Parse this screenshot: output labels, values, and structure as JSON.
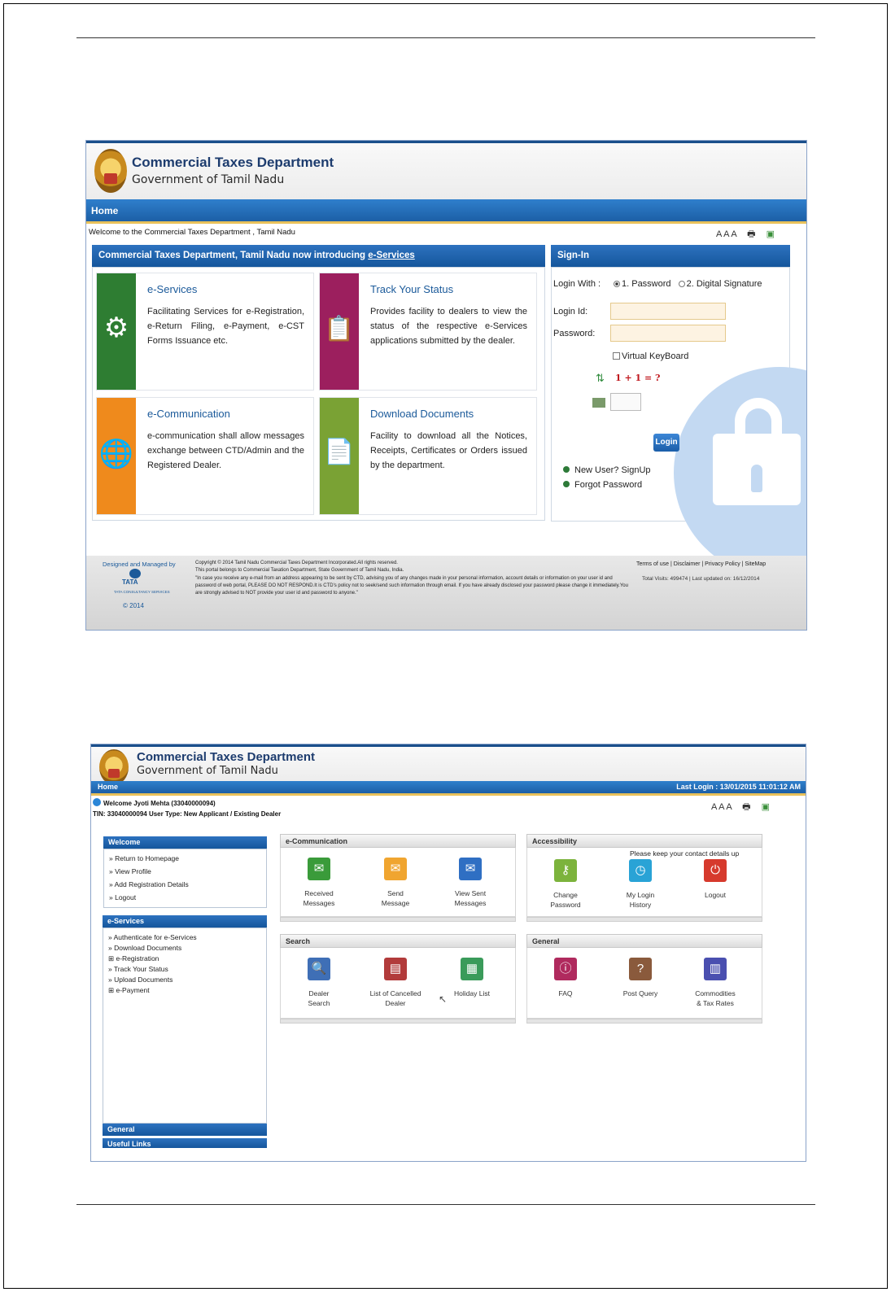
{
  "login_page": {
    "brand_title": "Commercial Taxes Department",
    "brand_subtitle": "Government of Tamil Nadu",
    "nav_home": "Home",
    "welcome_text": "Welcome to the Commercial Taxes Department , Tamil Nadu",
    "font_size_controls": "A A A",
    "intro_heading_prefix": "Commercial Taxes Department, Tamil Nadu now introducing ",
    "intro_heading_link": "e-Services",
    "cards": [
      {
        "title": "e-Services",
        "description": "Facilitating Services for e-Registration, e-Return Filing, e-Payment, e-CST Forms Issuance etc.",
        "color": "#2e7d32",
        "icon": "gears-icon"
      },
      {
        "title": "Track Your Status",
        "description": "Provides facility to dealers to view the status of the respective e-Services applications submitted by the dealer.",
        "color": "#9c1f5e",
        "icon": "clipboard-icon"
      },
      {
        "title": "e-Communication",
        "description": "e-communication shall allow messages exchange between CTD/Admin and the Registered Dealer.",
        "color": "#ef8a1c",
        "icon": "globe-icon"
      },
      {
        "title": "Download Documents",
        "description": "Facility to download all the Notices, Receipts, Certificates or Orders issued by the department.",
        "color": "#7aa234",
        "icon": "document-icon"
      }
    ],
    "signin": {
      "heading": "Sign-In",
      "login_with_label": "Login With :",
      "option1": "1. Password",
      "option2": "2. Digital Signature",
      "login_id_label": "Login Id:",
      "login_id_value": "",
      "password_label": "Password:",
      "password_value": "",
      "virtual_keyboard": "Virtual KeyBoard",
      "captcha": "1 + 1 = ?",
      "login_button": "Login",
      "new_user": "New User? SignUp",
      "forgot_password": "Forgot Password"
    },
    "footer": {
      "designed_by": "Designed and Managed by",
      "tata": "TATA",
      "tcs": "TATA CONSULTANCY SERVICES",
      "year": "© 2014",
      "copyright": "Copyright © 2014 Tamil Nadu Commercial Taxes Department Incorporated.All rights reserved.",
      "portal_note": "This portal belongs to Commercial Taxation Department, State Government of Tamil Nadu, India.",
      "warning": "\"In case you receive any e-mail from an address appearing to be sent by CTD, advising you of any changes made in your personal information, account details or information on your user id and password of web portal, PLEASE DO NOT RESPOND.It is CTD's policy not to seek/send such information through email. If you have already disclosed your password please change it immediately.You are strongly advised to NOT provide your user id and password to anyone.\"",
      "links": "Terms of use | Disclaimer | Privacy Policy | SiteMap",
      "visits": "Total Visits: 499474 | Last updated on: 16/12/2014"
    }
  },
  "dashboard": {
    "brand_title": "Commercial Taxes Department",
    "brand_subtitle": "Government of Tamil Nadu",
    "nav_home": "Home",
    "last_login": "Last Login : 13/01/2015 11:01:12 AM",
    "welcome_user": "Welcome Jyoti Mehta (33040000094)",
    "tin_line": "TIN: 33040000094   User Type: New Applicant / Existing Dealer",
    "font_size_controls": "A A A",
    "sidebar": {
      "welcome_heading": "Welcome",
      "welcome_items": [
        "» Return to Homepage",
        "» View Profile",
        "» Add Registration Details",
        "» Logout"
      ],
      "eservices_heading": "e-Services",
      "eservices_items": [
        "» Authenticate for e-Services",
        "» Download Documents",
        "⊞ e-Registration",
        "» Track Your Status",
        "» Upload Documents",
        "⊞ e-Payment"
      ],
      "general_heading": "General",
      "useful_links_heading": "Useful Links"
    },
    "widgets": {
      "ecommunication": {
        "title": "e-Communication",
        "tiles": [
          {
            "label1": "Received",
            "label2": "Messages",
            "color": "#3a9b3a",
            "icon": "envelope-icon"
          },
          {
            "label1": "Send",
            "label2": "Message",
            "color": "#f0a530",
            "icon": "send-mail-icon"
          },
          {
            "label1": "View Sent",
            "label2": "Messages",
            "color": "#2f6fc3",
            "icon": "sent-mail-icon"
          }
        ]
      },
      "accessibility": {
        "title": "Accessibility",
        "notice": "Please keep your contact details up",
        "tiles": [
          {
            "label1": "Change",
            "label2": "Password",
            "color": "#7cb33c",
            "icon": "key-icon"
          },
          {
            "label1": "My Login",
            "label2": "History",
            "color": "#29a3d6",
            "icon": "history-icon"
          },
          {
            "label1": "Logout",
            "label2": "",
            "color": "#d63a2d",
            "icon": "power-icon"
          }
        ]
      },
      "search": {
        "title": "Search",
        "tiles": [
          {
            "label1": "Dealer",
            "label2": "Search",
            "color": "#3f6fb6",
            "icon": "search-doc-icon"
          },
          {
            "label1": "List of Cancelled",
            "label2": "Dealer",
            "color": "#b23b3b",
            "icon": "cancelled-doc-icon"
          },
          {
            "label1": "Holiday List",
            "label2": "",
            "color": "#3a9b5a",
            "icon": "calendar-icon"
          }
        ]
      },
      "general": {
        "title": "General",
        "tiles": [
          {
            "label1": "FAQ",
            "label2": "",
            "color": "#b02a5e",
            "icon": "info-icon"
          },
          {
            "label1": "Post Query",
            "label2": "",
            "color": "#8a5a3c",
            "icon": "question-icon"
          },
          {
            "label1": "Commodities",
            "label2": "& Tax Rates",
            "color": "#4a4fb0",
            "icon": "bar-chart-icon"
          }
        ]
      }
    }
  }
}
